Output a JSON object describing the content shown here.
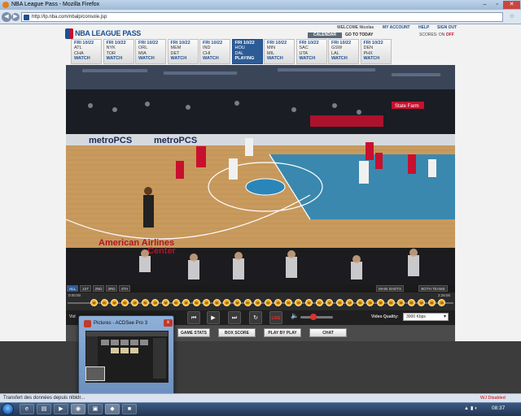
{
  "window": {
    "title": "NBA League Pass - Mozilla Firefox"
  },
  "browser": {
    "url": "http://lp.nba.com/nbalp/console.jsp",
    "back_icon": "back-arrow-icon",
    "forward_icon": "forward-arrow-icon"
  },
  "header": {
    "brand": "NBA LEAGUE PASS",
    "welcome": "WELCOME Nicolas",
    "my_account": "MY ACCOUNT",
    "help": "HELP",
    "sign_out": "SIGN OUT",
    "calendar": "CALENDAR",
    "go_to_today": "GO TO TODAY",
    "scores_label": "SCORES:",
    "scores_on": "ON",
    "scores_off": "OFF"
  },
  "games": [
    {
      "date": "FRI 10/22",
      "away": "ATL",
      "home": "CHA",
      "action": "WATCH"
    },
    {
      "date": "FRI 10/22",
      "away": "NYK",
      "home": "TOR",
      "action": "WATCH"
    },
    {
      "date": "FRI 10/22",
      "away": "ORL",
      "home": "MIA",
      "action": "WATCH"
    },
    {
      "date": "FRI 10/22",
      "away": "MEM",
      "home": "DET",
      "action": "WATCH"
    },
    {
      "date": "FRI 10/22",
      "away": "IND",
      "home": "CHI",
      "action": "WATCH"
    },
    {
      "date": "FRI 10/22",
      "away": "HOU",
      "home": "DAL",
      "action": "PLAYING"
    },
    {
      "date": "FRI 10/22",
      "away": "MIN",
      "home": "MIL",
      "action": "WATCH"
    },
    {
      "date": "FRI 10/22",
      "away": "SAC",
      "home": "UTA",
      "action": "WATCH"
    },
    {
      "date": "FRI 10/22",
      "away": "GSW",
      "home": "LAL",
      "action": "WATCH"
    },
    {
      "date": "FRI 10/22",
      "away": "DEN",
      "home": "PHX",
      "action": "WATCH"
    }
  ],
  "video": {
    "arena_text_1": "metroPCS",
    "arena_text_2": "metroPCS",
    "arena_text_3": "American Airlines",
    "arena_text_4": "Center",
    "arena_text_5": "State Farm"
  },
  "player": {
    "views": [
      "ALL",
      "1ST",
      "2ND",
      "3RD",
      "4TH"
    ],
    "main_shots": "MAIN SHOTS",
    "both_teams": "BOTH TEAMS",
    "time_start": "0:00:00",
    "time_end": "2:28:00",
    "marker_label": "M",
    "marker_count": 35,
    "live": "LIVE",
    "video_quality_label": "Video Quality:",
    "video_quality_value": "3000 Kbps",
    "video_label": "Vid"
  },
  "tabs": [
    "GAME STATS",
    "BOX SCORE",
    "PLAY BY PLAY",
    "CHAT"
  ],
  "popup": {
    "title": "Pictures - ACDSee Pro 3",
    "close": "x"
  },
  "status": {
    "text": "Transfert des données depuis nlbldr...",
    "right": "WJ Disabled"
  },
  "taskbar": {
    "clock": "08:37"
  }
}
